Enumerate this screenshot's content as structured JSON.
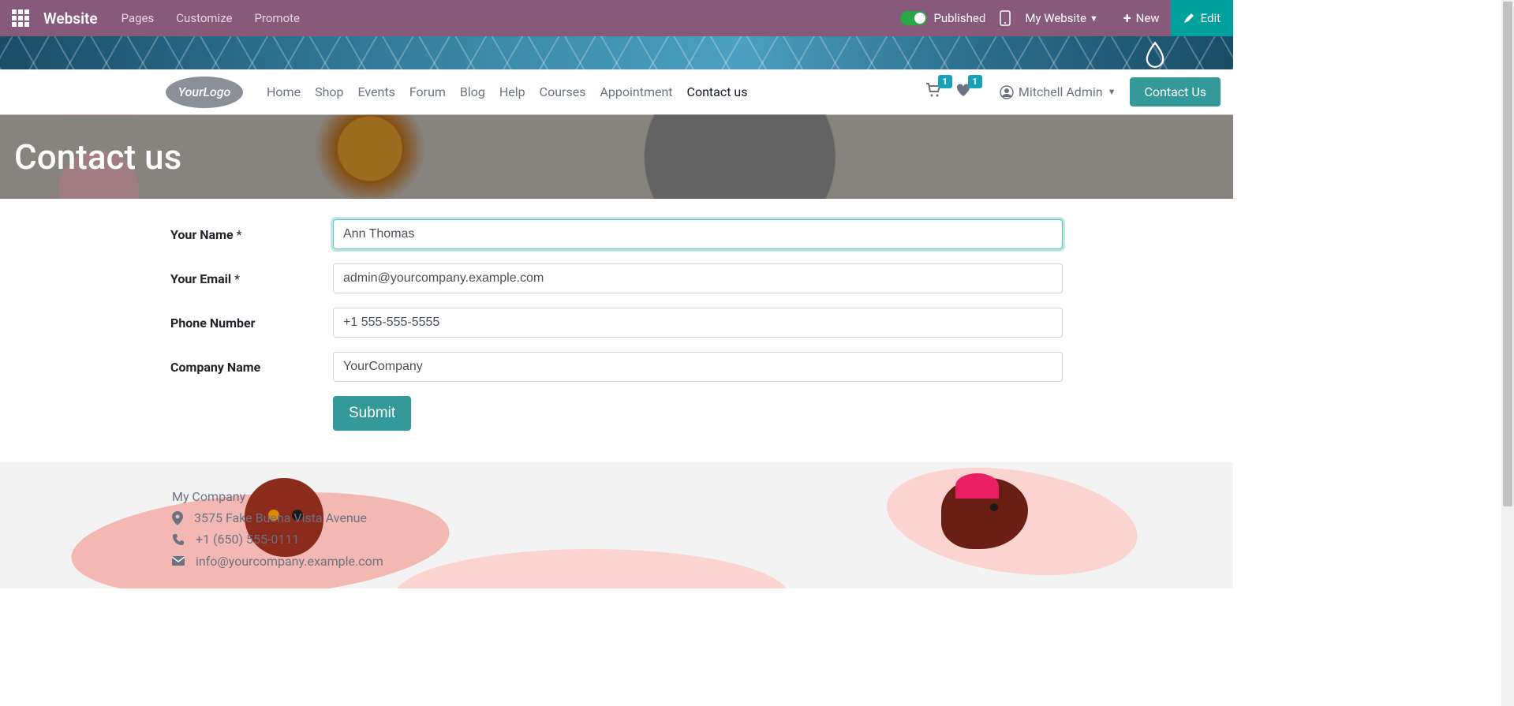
{
  "admin": {
    "brand": "Website",
    "menu": [
      "Pages",
      "Customize",
      "Promote"
    ],
    "published_label": "Published",
    "my_website_label": "My Website",
    "new_label": "New",
    "edit_label": "Edit"
  },
  "nav": {
    "logo_text_1": "Your",
    "logo_text_2": "Logo",
    "items": [
      {
        "label": "Home"
      },
      {
        "label": "Shop"
      },
      {
        "label": "Events"
      },
      {
        "label": "Forum"
      },
      {
        "label": "Blog"
      },
      {
        "label": "Help"
      },
      {
        "label": "Courses"
      },
      {
        "label": "Appointment"
      },
      {
        "label": "Contact us",
        "active": true
      }
    ],
    "cart_count": "1",
    "wishlist_count": "1",
    "user_name": "Mitchell Admin",
    "contact_btn": "Contact Us"
  },
  "hero": {
    "title": "Contact us"
  },
  "form": {
    "fields": [
      {
        "label": "Your Name",
        "required": true,
        "value": "Ann Thomas",
        "focused": true
      },
      {
        "label": "Your Email",
        "required": true,
        "value": "admin@yourcompany.example.com"
      },
      {
        "label": "Phone Number",
        "required": false,
        "value": "+1 555-555-5555"
      },
      {
        "label": "Company Name",
        "required": false,
        "value": "YourCompany"
      }
    ],
    "submit_label": "Submit",
    "required_marker": "*"
  },
  "footer": {
    "company": "My Company",
    "address": "3575 Fake Buena Vista Avenue",
    "phone": "+1 (650) 555-0111",
    "email": "info@yourcompany.example.com"
  }
}
